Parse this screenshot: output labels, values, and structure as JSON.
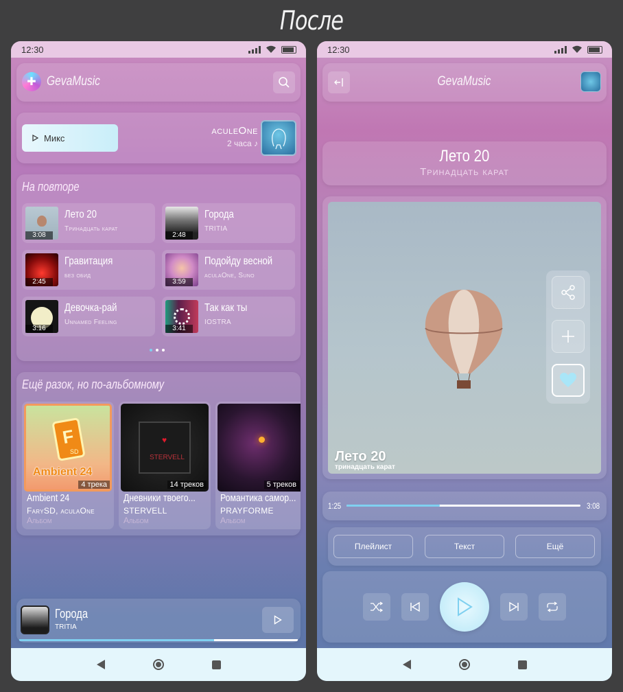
{
  "heading": "После",
  "colors": {
    "accent": "#7fd0f0",
    "navbar": "#e4f6fc",
    "statusbar": "#e9c9e4"
  },
  "left": {
    "status": {
      "time": "12:30"
    },
    "app_name": "GevaMusic",
    "mix": {
      "label": "Микс"
    },
    "artist": {
      "name": "aculeOne",
      "duration": "2 часа ♪"
    },
    "section1_title": "На повторе",
    "tracks": [
      {
        "title": "Лето 20",
        "artist": "Тринадцать карат",
        "duration": "3:08"
      },
      {
        "title": "Города",
        "artist": "TRITIA",
        "duration": "2:48"
      },
      {
        "title": "Гравитация",
        "artist": "без обид",
        "duration": "2:45"
      },
      {
        "title": "Подойду весной",
        "artist": "aculaOne, Suno",
        "duration": "3:59"
      },
      {
        "title": "Девочка-рай",
        "artist": "Unnamed Feeling",
        "duration": "3:16"
      },
      {
        "title": "Так как ты",
        "artist": "IOSTRA",
        "duration": "3:41"
      }
    ],
    "section2_title": "Ещё разок, но по-альбомному",
    "albums": [
      {
        "title": "Ambient 24",
        "artist": "FarySD, aculaOne",
        "type": "Альбом",
        "count": "4 трека",
        "cover_text": "Ambient 24",
        "cover_letter": "F",
        "cover_sub": "SD"
      },
      {
        "title": "Дневники твоего...",
        "artist": "STERVELL",
        "type": "Альбом",
        "count": "14 треков",
        "cover_text": "STERVELL"
      },
      {
        "title": "Романтика самор...",
        "artist": "PRAYFORME",
        "type": "Альбом",
        "count": "5 треков"
      }
    ],
    "mini_player": {
      "title": "Города",
      "artist": "TRITIA",
      "progress": 0.7
    }
  },
  "right": {
    "status": {
      "time": "12:30"
    },
    "app_name": "GevaMusic",
    "now_playing": {
      "title": "Лето 20",
      "artist": "Тринадцать карат"
    },
    "cover_caption": {
      "title": "Лето 20",
      "artist": "тринадцать карат"
    },
    "progress": {
      "current": "1:25",
      "total": "3:08",
      "fraction": 0.4
    },
    "tabs": [
      "Плейлист",
      "Текст",
      "Ещё"
    ]
  }
}
